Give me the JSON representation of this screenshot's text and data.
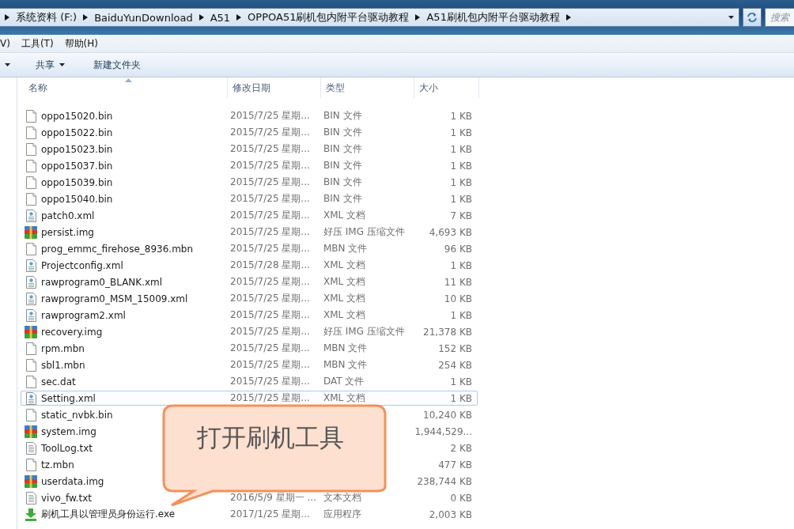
{
  "address_bar": {
    "crumbs": [
      "系统资料 (F:)",
      "BaiduYunDownload",
      "A51",
      "OPPOA51刷机包内附平台驱动教程",
      "A51刷机包内附平台驱动教程"
    ]
  },
  "search": {
    "placeholder": "搜索"
  },
  "menu_bar": {
    "items": [
      "V)",
      "工具(T)",
      "帮助(H)"
    ]
  },
  "toolbar": {
    "items": [
      {
        "label": "共享",
        "dropdown": true
      },
      {
        "label": "新建文件夹",
        "dropdown": false
      }
    ]
  },
  "table": {
    "columns": [
      "名称",
      "修改日期",
      "类型",
      "大小"
    ],
    "rows": [
      {
        "name": "oppo15020.bin",
        "date": "2015/7/25 星期...",
        "type": "BIN 文件",
        "size": "1 KB",
        "kind": "file",
        "selected": false
      },
      {
        "name": "oppo15022.bin",
        "date": "2015/7/25 星期...",
        "type": "BIN 文件",
        "size": "1 KB",
        "kind": "file",
        "selected": false
      },
      {
        "name": "oppo15023.bin",
        "date": "2015/7/25 星期...",
        "type": "BIN 文件",
        "size": "1 KB",
        "kind": "file",
        "selected": false
      },
      {
        "name": "oppo15037.bin",
        "date": "2015/7/25 星期...",
        "type": "BIN 文件",
        "size": "1 KB",
        "kind": "file",
        "selected": false
      },
      {
        "name": "oppo15039.bin",
        "date": "2015/7/25 星期...",
        "type": "BIN 文件",
        "size": "1 KB",
        "kind": "file",
        "selected": false
      },
      {
        "name": "oppo15040.bin",
        "date": "2015/7/25 星期...",
        "type": "BIN 文件",
        "size": "1 KB",
        "kind": "file",
        "selected": false
      },
      {
        "name": "patch0.xml",
        "date": "2015/7/25 星期...",
        "type": "XML 文档",
        "size": "7 KB",
        "kind": "xml",
        "selected": false
      },
      {
        "name": "persist.img",
        "date": "2015/7/25 星期...",
        "type": "好压 IMG 压缩文件",
        "size": "4,693 KB",
        "kind": "archive",
        "selected": false
      },
      {
        "name": "prog_emmc_firehose_8936.mbn",
        "date": "2015/7/25 星期...",
        "type": "MBN 文件",
        "size": "96 KB",
        "kind": "file",
        "selected": false
      },
      {
        "name": "Projectconfig.xml",
        "date": "2015/7/28 星期...",
        "type": "XML 文档",
        "size": "1 KB",
        "kind": "xml",
        "selected": false
      },
      {
        "name": "rawprogram0_BLANK.xml",
        "date": "2015/7/25 星期...",
        "type": "XML 文档",
        "size": "11 KB",
        "kind": "xml",
        "selected": false
      },
      {
        "name": "rawprogram0_MSM_15009.xml",
        "date": "2015/7/25 星期...",
        "type": "XML 文档",
        "size": "10 KB",
        "kind": "xml",
        "selected": false
      },
      {
        "name": "rawprogram2.xml",
        "date": "2015/7/25 星期...",
        "type": "XML 文档",
        "size": "1 KB",
        "kind": "xml",
        "selected": false
      },
      {
        "name": "recovery.img",
        "date": "2015/7/25 星期...",
        "type": "好压 IMG 压缩文件",
        "size": "21,378 KB",
        "kind": "archive",
        "selected": false
      },
      {
        "name": "rpm.mbn",
        "date": "2015/7/25 星期...",
        "type": "MBN 文件",
        "size": "152 KB",
        "kind": "file",
        "selected": false
      },
      {
        "name": "sbl1.mbn",
        "date": "2015/7/25 星期...",
        "type": "MBN 文件",
        "size": "254 KB",
        "kind": "file",
        "selected": false
      },
      {
        "name": "sec.dat",
        "date": "2015/7/25 星期...",
        "type": "DAT 文件",
        "size": "1 KB",
        "kind": "file",
        "selected": false
      },
      {
        "name": "Setting.xml",
        "date": "2015/7/25 星期...",
        "type": "XML 文档",
        "size": "1 KB",
        "kind": "xml",
        "selected": true
      },
      {
        "name": "static_nvbk.bin",
        "size": "10,240 KB",
        "kind": "file",
        "selected": false
      },
      {
        "name": "system.img",
        "size": "1,944,529...",
        "kind": "archive",
        "selected": false
      },
      {
        "name": "ToolLog.txt",
        "size": "2 KB",
        "kind": "text",
        "selected": false
      },
      {
        "name": "tz.mbn",
        "size": "477 KB",
        "kind": "file",
        "selected": false
      },
      {
        "name": "userdata.img",
        "size": "238,744 KB",
        "kind": "archive",
        "selected": false
      },
      {
        "name": "vivo_fw.txt",
        "date": "2016/5/9 星期一 ...",
        "type": "文本文档",
        "size": "0 KB",
        "kind": "text",
        "selected": false
      },
      {
        "name": "刷机工具以管理员身份运行.exe",
        "date": "2017/1/25 星期...",
        "type": "应用程序",
        "size": "2,003 KB",
        "kind": "installer",
        "selected": false
      }
    ]
  },
  "callout": {
    "text": "打开刷机工具"
  }
}
